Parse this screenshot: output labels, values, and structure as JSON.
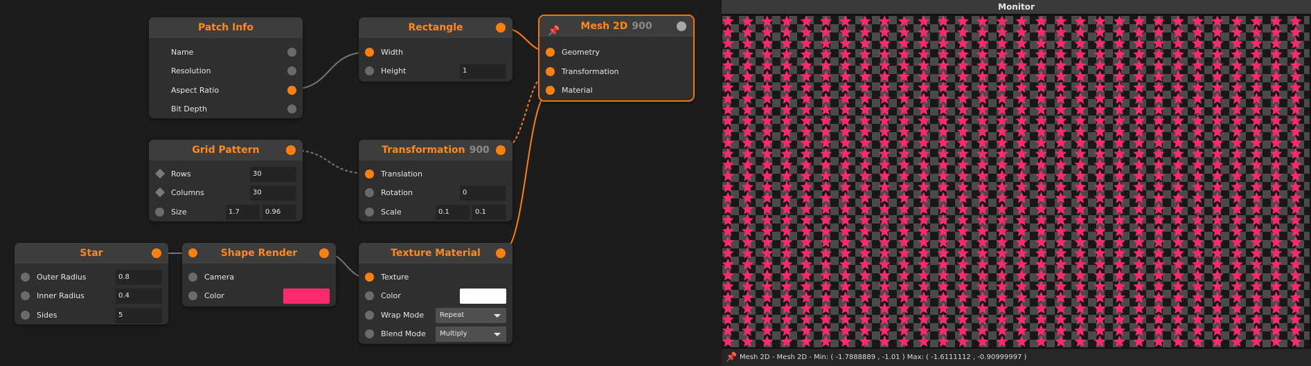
{
  "nodes": {
    "patch_info": {
      "title": "Patch Info",
      "inputs": [
        "Name",
        "Resolution",
        "Aspect Ratio",
        "Bit Depth"
      ]
    },
    "rectangle": {
      "title": "Rectangle",
      "width_label": "Width",
      "height_label": "Height",
      "height_value": "1"
    },
    "mesh2d": {
      "title": "Mesh 2D",
      "badge": "900",
      "inputs": [
        "Geometry",
        "Transformation",
        "Material"
      ]
    },
    "grid_pattern": {
      "title": "Grid Pattern",
      "rows_label": "Rows",
      "rows_value": "30",
      "columns_label": "Columns",
      "columns_value": "30",
      "size_label": "Size",
      "size_x": "1.7",
      "size_y": "0.96"
    },
    "transformation": {
      "title": "Transformation",
      "badge": "900",
      "translation_label": "Translation",
      "rotation_label": "Rotation",
      "rotation_value": "0",
      "scale_label": "Scale",
      "scale_x": "0.1",
      "scale_y": "0.1"
    },
    "star": {
      "title": "Star",
      "outer_label": "Outer Radius",
      "outer_value": "0.8",
      "inner_label": "Inner Radius",
      "inner_value": "0.4",
      "sides_label": "Sides",
      "sides_value": "5"
    },
    "shape_render": {
      "title": "Shape Render",
      "camera_label": "Camera",
      "color_label": "Color",
      "color_value": "#ff2a6d"
    },
    "texture_material": {
      "title": "Texture Material",
      "texture_label": "Texture",
      "color_label": "Color",
      "color_value": "#ffffff",
      "wrap_label": "Wrap Mode",
      "wrap_value": "Repeat",
      "blend_label": "Blend Mode",
      "blend_value": "Multiply"
    }
  },
  "monitor": {
    "title": "Monitor",
    "status": "Mesh 2D - Mesh 2D - Min: ( -1.7888889 , -1.01 )  Max: ( -1.6111112 , -0.90999997 )",
    "grid_rows": 30,
    "grid_columns": 30,
    "star_color": "#ff2a6d",
    "checker_light": "#4a4a4a",
    "checker_dark": "#181818"
  },
  "colors": {
    "accent": "#ff7f0f",
    "wire": "#707070",
    "background": "#1c1c1c"
  }
}
